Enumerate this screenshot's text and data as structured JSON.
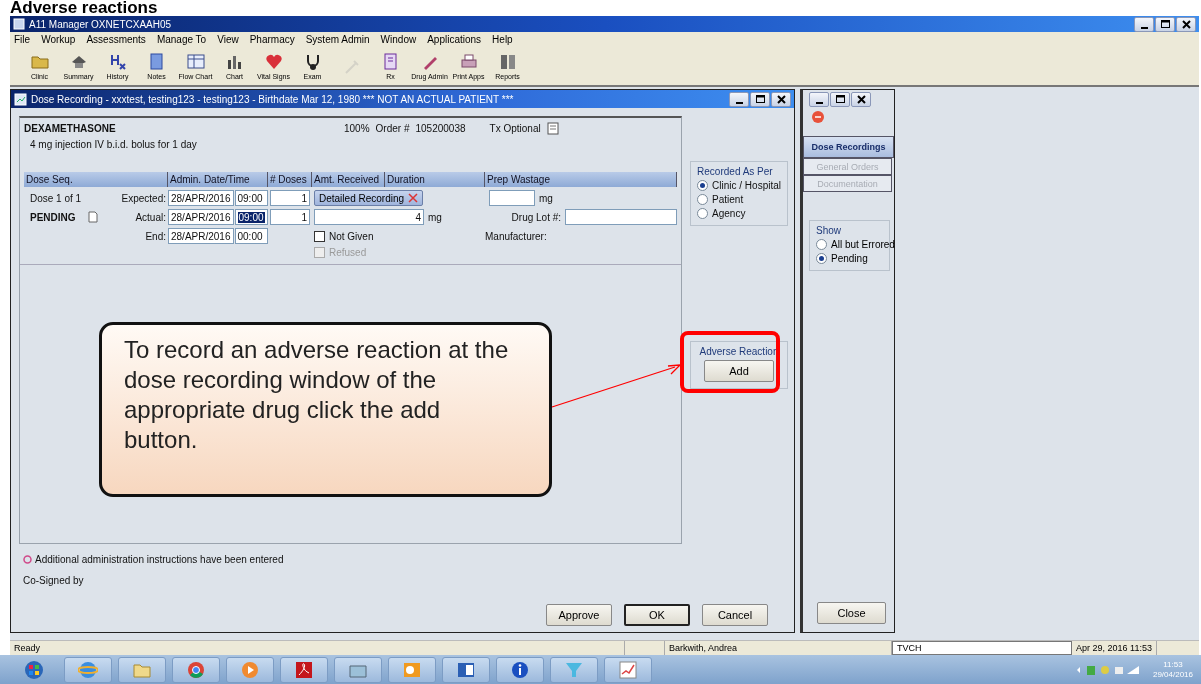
{
  "heading": "Adverse reactions",
  "app": {
    "title": "A11 Manager OXNETCXAAH05"
  },
  "menu": [
    "File",
    "Workup",
    "Assessments",
    "Manage To",
    "View",
    "Pharmacy",
    "System Admin",
    "Window",
    "Applications",
    "Help"
  ],
  "toolbar": [
    {
      "label": "Clinic",
      "disabled": false
    },
    {
      "label": "Summary",
      "disabled": false
    },
    {
      "label": "History",
      "disabled": false
    },
    {
      "label": "Notes",
      "disabled": false
    },
    {
      "label": "Flow Chart",
      "disabled": false
    },
    {
      "label": "Chart",
      "disabled": false
    },
    {
      "label": "Vital Signs",
      "disabled": false
    },
    {
      "label": "Exam",
      "disabled": false
    },
    {
      "disabled": true
    },
    {
      "label": "Rx",
      "disabled": false
    },
    {
      "label": "Drug Admin",
      "disabled": false
    },
    {
      "label": "Print Apps",
      "disabled": false
    },
    {
      "label": "Reports",
      "disabled": false
    }
  ],
  "dose_window": {
    "title": "Dose Recording - xxxtest, testing123 - testing123 - Birthdate Mar 12, 1980 *** NOT AN ACTUAL PATIENT ***",
    "drug": "DEXAMETHASONE",
    "percent": "100%",
    "order_label": "Order #",
    "order_number": "105200038",
    "tx": "Tx Optional",
    "instruction": "4 mg injection IV b.i.d. bolus for 1 day",
    "columns": [
      "Dose Seq.",
      "Admin. Date/Time",
      "# Doses",
      "Amt. Received",
      "Duration",
      "Prep Wastage"
    ],
    "dose_seq": "Dose 1 of 1",
    "status": "PENDING",
    "times": [
      {
        "label": "Expected:",
        "date": "28/APR/2016",
        "time": "09:00",
        "selected": false,
        "doses": "1"
      },
      {
        "label": "Actual:",
        "date": "28/APR/2016",
        "time": "09:00",
        "selected": true,
        "doses": "1"
      },
      {
        "label": "End:",
        "date": "28/APR/2016",
        "time": "00:00",
        "selected": false
      }
    ],
    "detailed_recording": "Detailed Recording",
    "amount": "4",
    "amount_unit": "mg",
    "checks": [
      {
        "label": "Not Given",
        "checked": false,
        "disabled": false
      },
      {
        "label": "Refused",
        "checked": false,
        "disabled": true
      }
    ],
    "prep_wastage_unit": "mg",
    "drug_lot_label": "Drug Lot #:",
    "manufacturer_label": "Manufacturer:",
    "recorded_as": {
      "title": "Recorded As Per",
      "options": [
        {
          "label": "Clinic / Hospital",
          "selected": true
        },
        {
          "label": "Patient",
          "selected": false
        },
        {
          "label": "Agency",
          "selected": false
        }
      ]
    },
    "adverse_reaction": {
      "title": "Adverse Reaction",
      "button": "Add"
    },
    "note": "Additional administration instructions have been entered",
    "cosigned": "Co-Signed by",
    "buttons": [
      "Approve",
      "OK",
      "Cancel"
    ]
  },
  "side_panel": {
    "tabs": [
      {
        "label": "Dose Recordings",
        "selected": true,
        "disabled": false
      },
      {
        "label": "General Orders",
        "selected": false,
        "disabled": true
      },
      {
        "label": "Documentation",
        "selected": false,
        "disabled": true
      }
    ],
    "show": {
      "title": "Show",
      "options": [
        {
          "label": "All but Errored",
          "selected": false
        },
        {
          "label": "Pending",
          "selected": true
        }
      ]
    },
    "close": "Close"
  },
  "status_bar": [
    "Ready",
    "Barkwith, Andrea",
    "TVCH",
    "Apr 29, 2016 11:53"
  ],
  "clock": {
    "time": "11:53",
    "date": "29/04/2016"
  },
  "callout": "To record an adverse reaction at the dose recording window of the appropriate drug click the add button."
}
